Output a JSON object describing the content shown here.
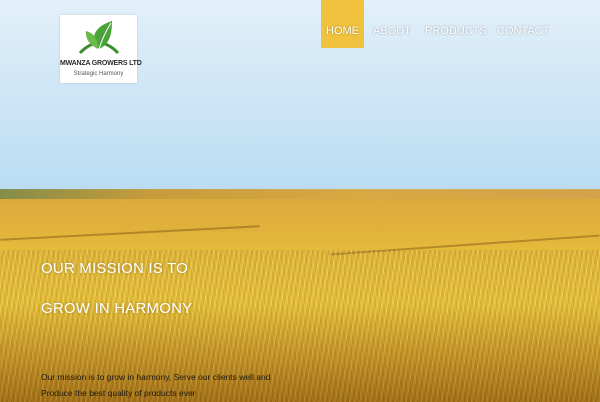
{
  "logo": {
    "name": "MWANZA GROWERS LTD",
    "tagline": "Strategic Harmony",
    "icon": "leaf-icon",
    "colors": {
      "leaf": "#4aa33a",
      "arc": "#3b8f2f"
    }
  },
  "nav": {
    "items": [
      {
        "label": "HOME",
        "active": true
      },
      {
        "label": "ABOUT",
        "active": false
      },
      {
        "label": "PRODUCTS",
        "active": false
      },
      {
        "label": "CONTACT",
        "active": false
      }
    ],
    "active_color": "#f0c23d"
  },
  "hero": {
    "headline_line1": "OUR MISSION IS TO",
    "headline_line2": "GROW IN HARMONY",
    "body_line1": "Our mission is to grow in harmony, Serve our clients well and",
    "body_line2": "Produce the best quality of products ever"
  }
}
